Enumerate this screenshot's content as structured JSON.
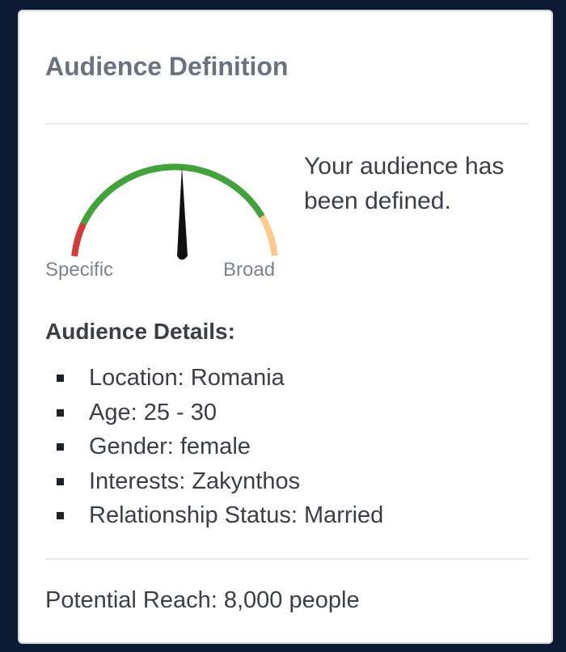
{
  "panel": {
    "title": "Audience Definition"
  },
  "gauge": {
    "label_left": "Specific",
    "label_right": "Broad",
    "colors": {
      "left_zone": "#d13a37",
      "middle_zone": "#44a23c",
      "right_zone": "#fdc98c",
      "needle": "#111111"
    }
  },
  "status": {
    "message": "Your audience has been defined."
  },
  "details": {
    "heading": "Audience Details:",
    "items": [
      {
        "text": "Location: Romania"
      },
      {
        "text": "Age: 25 - 30"
      },
      {
        "text": "Gender: female"
      },
      {
        "text": "Interests: Zakynthos"
      },
      {
        "text": "Relationship Status: Married"
      }
    ]
  },
  "reach": {
    "text": "Potential Reach: 8,000 people"
  }
}
